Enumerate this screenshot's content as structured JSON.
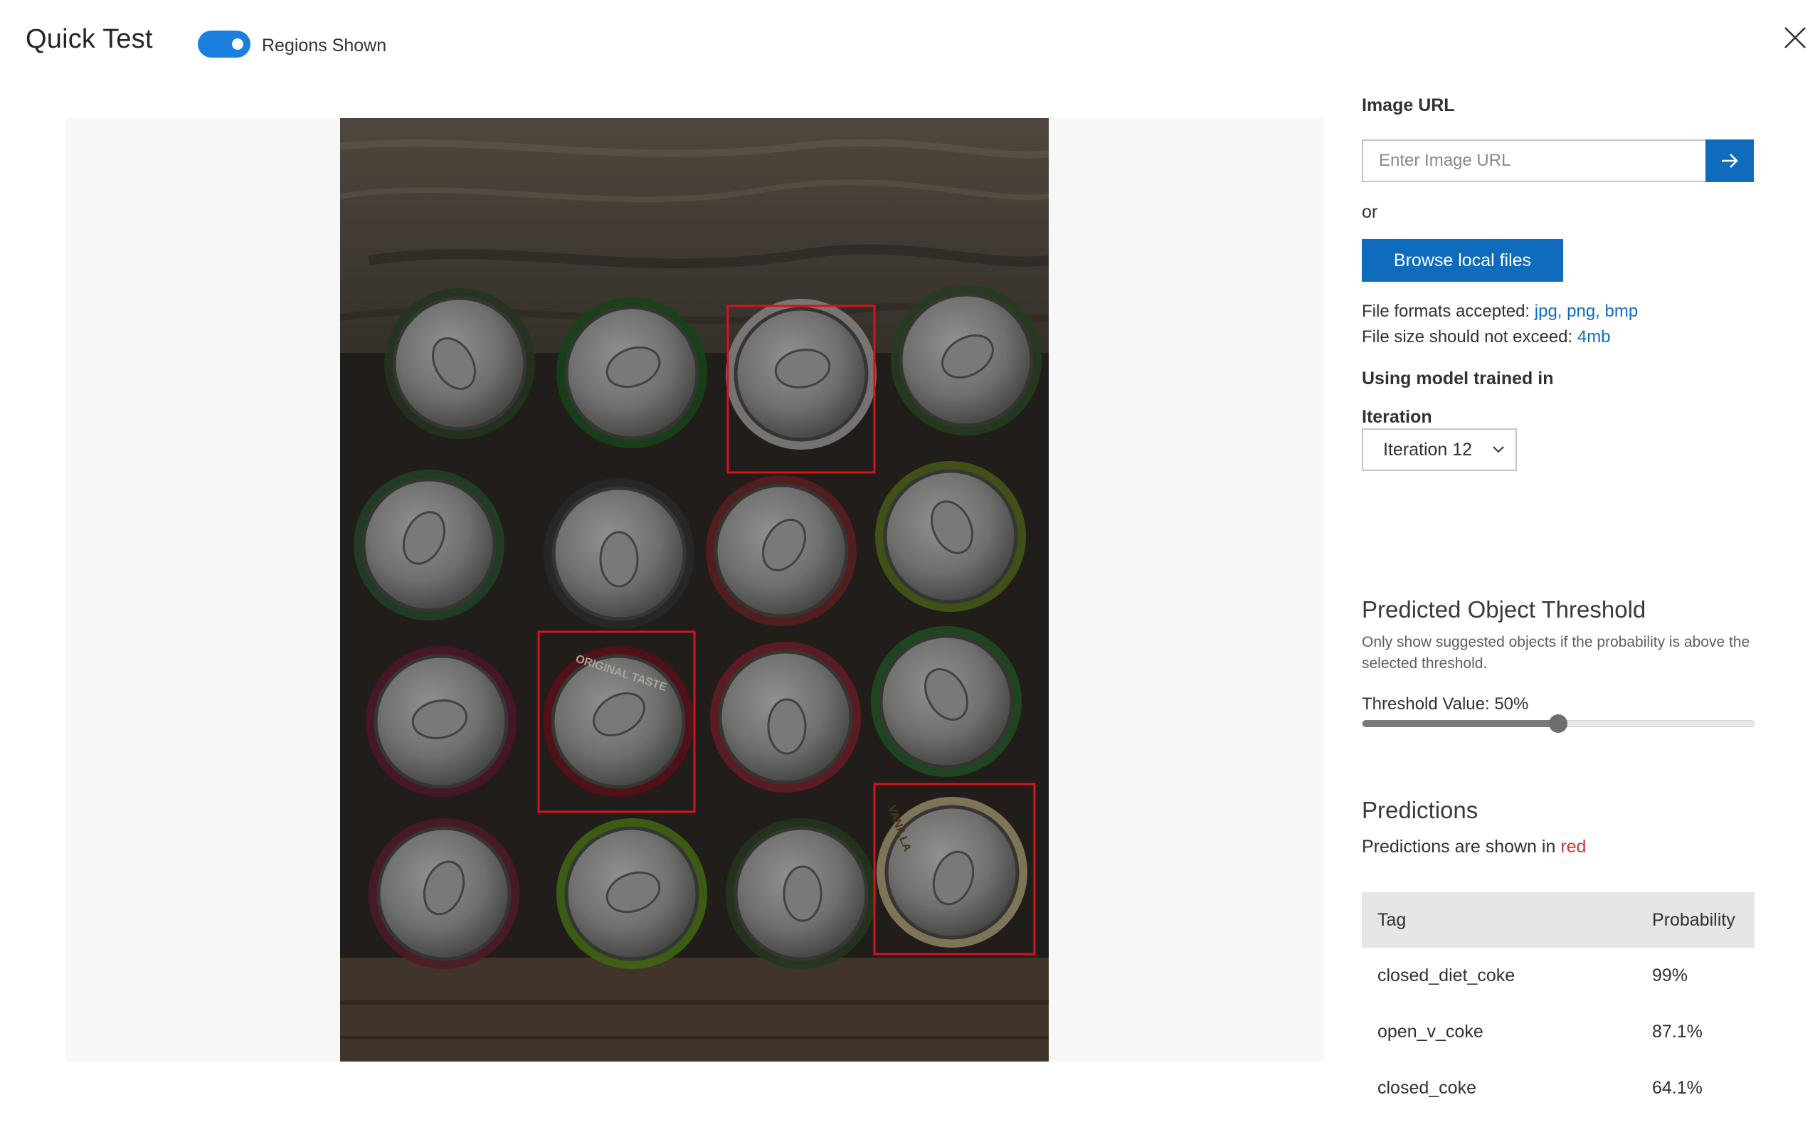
{
  "header": {
    "title": "Quick Test",
    "regions_toggle_label": "Regions Shown",
    "regions_toggle_on": true
  },
  "image_url": {
    "label": "Image URL",
    "placeholder": "Enter Image URL",
    "value": ""
  },
  "or_text": "or",
  "browse_button_label": "Browse local files",
  "file_info": {
    "formats_prefix": "File formats accepted: ",
    "formats": "jpg, png, bmp",
    "size_prefix": "File size should not exceed: ",
    "size": "4mb"
  },
  "model_label": "Using model trained in",
  "iteration": {
    "label": "Iteration",
    "selected": "Iteration 12"
  },
  "threshold": {
    "title": "Predicted Object Threshold",
    "description": "Only show suggested objects if the probability is above the selected threshold.",
    "value_label": "Threshold Value: 50%",
    "value_fraction": 0.5
  },
  "predictions": {
    "title": "Predictions",
    "note_prefix": "Predictions are shown in ",
    "note_color_word": "red",
    "columns": [
      "Tag",
      "Probability"
    ],
    "rows": [
      {
        "tag": "closed_diet_coke",
        "probability": "99%"
      },
      {
        "tag": "open_v_coke",
        "probability": "87.1%"
      },
      {
        "tag": "closed_coke",
        "probability": "64.1%"
      }
    ]
  },
  "photo": {
    "can_labels": [
      "ORIGINAL TASTE",
      "VANILLA"
    ]
  },
  "colors": {
    "accent": "#0f6cbd",
    "toggle_on": "#1b7fe0",
    "prediction_box": "#d3141c",
    "panel_background": "#f7f7f7"
  },
  "icons": {
    "close": "close-icon",
    "go": "arrow-right-icon",
    "dropdown": "chevron-down-icon"
  }
}
